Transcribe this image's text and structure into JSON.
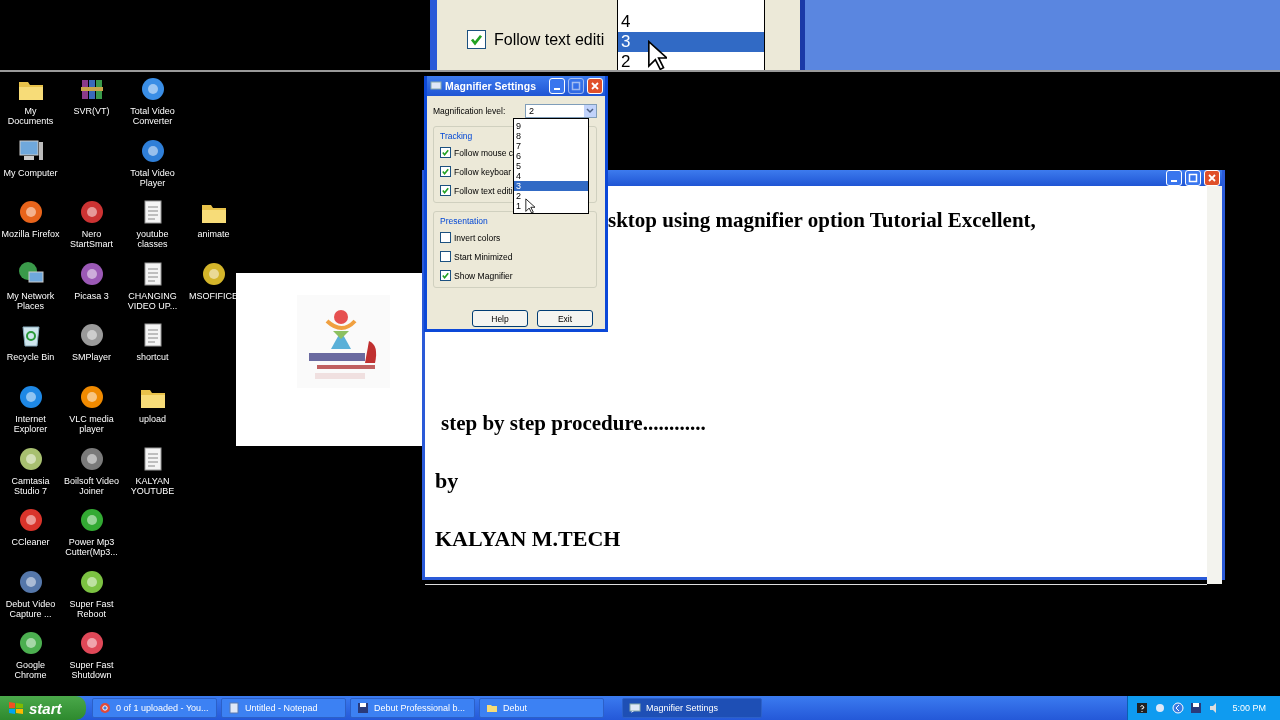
{
  "magnifier_view": {
    "checkboxes": [
      {
        "label": "Follow text editi",
        "checked": true
      }
    ],
    "list_items": [
      {
        "label": "4",
        "selected": false
      },
      {
        "label": "3",
        "selected": true
      },
      {
        "label": "2",
        "selected": false
      }
    ]
  },
  "desktop_icons": [
    {
      "label": "My Documents",
      "kind": "folder"
    },
    {
      "label": "SVR(VT)",
      "kind": "archive"
    },
    {
      "label": "Total Video Converter",
      "kind": "app",
      "color": "#3a8ee6"
    },
    {
      "label": "My Computer",
      "kind": "computer"
    },
    {
      "label": "Total Video Player",
      "kind": "app",
      "color": "#2f7fd8"
    },
    {
      "label": "Mozilla Firefox",
      "kind": "app",
      "color": "#e8641b"
    },
    {
      "label": "Nero StartSmart",
      "kind": "app",
      "color": "#cc3333"
    },
    {
      "label": "youtube classes",
      "kind": "document"
    },
    {
      "label": "animate",
      "kind": "folder"
    },
    {
      "label": "My Network Places",
      "kind": "network"
    },
    {
      "label": "Picasa 3",
      "kind": "app",
      "color": "#9b59b6"
    },
    {
      "label": "CHANGING VIDEO UP...",
      "kind": "document"
    },
    {
      "label": "MSOFIFICE",
      "kind": "app",
      "color": "#d4b52a"
    },
    {
      "label": "Recycle Bin",
      "kind": "recycle"
    },
    {
      "label": "SMPlayer",
      "kind": "app",
      "color": "#9a9a9a"
    },
    {
      "label": "shortcut",
      "kind": "document"
    },
    {
      "label": "Internet Explorer",
      "kind": "app",
      "color": "#1e88e5"
    },
    {
      "label": "VLC media player",
      "kind": "app",
      "color": "#f08a00"
    },
    {
      "label": "upload",
      "kind": "folder"
    },
    {
      "label": "Camtasia Studio 7",
      "kind": "app",
      "color": "#a8c070"
    },
    {
      "label": "Boilsoft Video Joiner",
      "kind": "app",
      "color": "#7a7a7a"
    },
    {
      "label": "KALYAN YOUTUBE",
      "kind": "document"
    },
    {
      "label": "CCleaner",
      "kind": "app",
      "color": "#d9342b"
    },
    {
      "label": "Power Mp3 Cutter(Mp3...",
      "kind": "app",
      "color": "#33aa33"
    },
    {
      "label": "Debut Video Capture ...",
      "kind": "app",
      "color": "#5577aa"
    },
    {
      "label": "Super Fast Reboot",
      "kind": "app",
      "color": "#7cc242"
    },
    {
      "label": "Google Chrome",
      "kind": "app",
      "color": "#4caf50"
    },
    {
      "label": "Super Fast Shutdown",
      "kind": "app",
      "color": "#e04858"
    }
  ],
  "document_window": {
    "lines": [
      {
        "text": "sktop using magnifier option Tutorial Excellent,",
        "kind": "partial"
      },
      {
        "text": "step by step procedure............",
        "kind": "indented"
      },
      {
        "text": "by",
        "kind": "plain"
      },
      {
        "text": "KALYAN M.TECH",
        "kind": "plain"
      }
    ]
  },
  "magnifier_dialog": {
    "title": "Magnifier Settings",
    "level_label": "Magnification level:",
    "level_value": "2",
    "level_options": [
      {
        "label": "9",
        "selected": false
      },
      {
        "label": "8",
        "selected": false
      },
      {
        "label": "7",
        "selected": false
      },
      {
        "label": "6",
        "selected": false
      },
      {
        "label": "5",
        "selected": false
      },
      {
        "label": "4",
        "selected": false
      },
      {
        "label": "3",
        "selected": true
      },
      {
        "label": "2",
        "selected": false
      },
      {
        "label": "1",
        "selected": false
      }
    ],
    "tracking_title": "Tracking",
    "tracking": [
      {
        "label": "Follow mouse c",
        "checked": true
      },
      {
        "label": "Follow keyboar",
        "checked": true
      },
      {
        "label": "Follow text editi",
        "checked": true
      }
    ],
    "presentation_title": "Presentation",
    "presentation": [
      {
        "label": "Invert colors",
        "checked": false
      },
      {
        "label": "Start Minimized",
        "checked": false
      },
      {
        "label": "Show Magnifier",
        "checked": true
      }
    ],
    "buttons": [
      "Help",
      "Exit"
    ]
  },
  "taskbar": {
    "start": "start",
    "tasks": [
      {
        "label": "0 of 1 uploaded - You...",
        "kind": "browser",
        "selected": false
      },
      {
        "label": "Untitled - Notepad",
        "kind": "notepad",
        "selected": false
      },
      {
        "label": "Debut Professional b...",
        "kind": "disk",
        "selected": false
      },
      {
        "label": "Debut",
        "kind": "folder",
        "selected": false
      },
      {
        "label": "Magnifier Settings",
        "kind": "magnifier",
        "selected": true
      }
    ],
    "clock": "5:00 PM"
  }
}
